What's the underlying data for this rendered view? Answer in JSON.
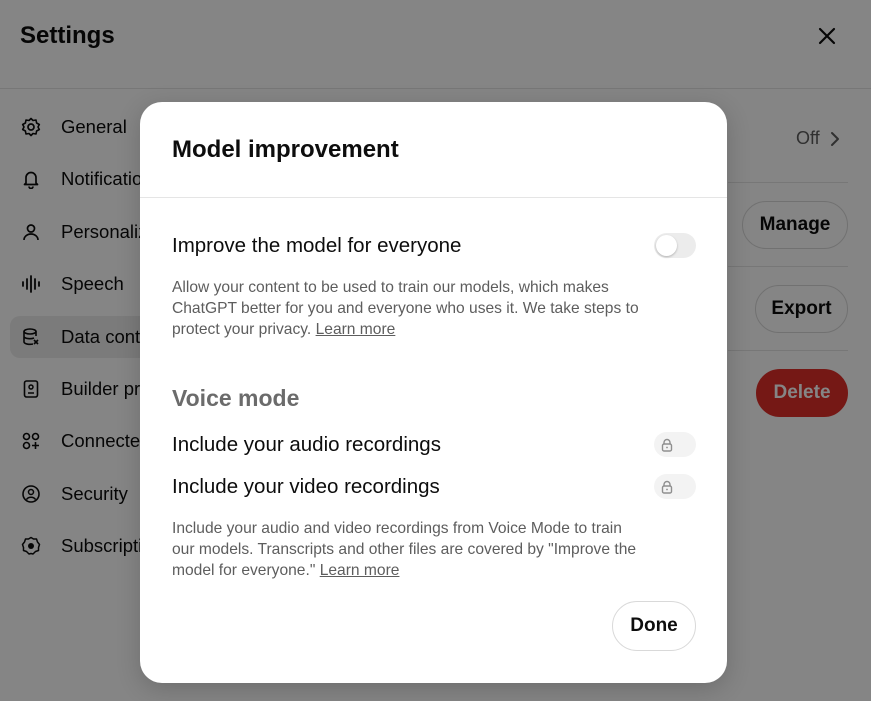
{
  "settings": {
    "title": "Settings",
    "sidebar": [
      {
        "label": "General",
        "icon": "gear-icon"
      },
      {
        "label": "Notifications",
        "icon": "bell-icon"
      },
      {
        "label": "Personalization",
        "icon": "person-icon"
      },
      {
        "label": "Speech",
        "icon": "waveform-icon"
      },
      {
        "label": "Data controls",
        "icon": "database-icon",
        "active": true
      },
      {
        "label": "Builder profile",
        "icon": "id-card-icon"
      },
      {
        "label": "Connected apps",
        "icon": "apps-icon"
      },
      {
        "label": "Security",
        "icon": "shield-icon"
      },
      {
        "label": "Subscription",
        "icon": "subscription-icon"
      }
    ],
    "content": {
      "improve_value": "Off",
      "manage_label": "Manage",
      "export_label": "Export",
      "delete_label": "Delete"
    }
  },
  "modal": {
    "title": "Model improvement",
    "improve": {
      "label": "Improve the model for everyone",
      "enabled": false,
      "description": "Allow your content to be used to train our models, which makes ChatGPT better for you and everyone who uses it. We take steps to protect your privacy.",
      "link": "Learn more"
    },
    "voice": {
      "section_title": "Voice mode",
      "audio_label": "Include your audio recordings",
      "video_label": "Include your video recordings",
      "audio_locked": true,
      "video_locked": true,
      "description": "Include your audio and video recordings from Voice Mode to train our models. Transcripts and other files are covered by \"Improve the model for everyone.\"",
      "link": "Learn more"
    },
    "done_label": "Done"
  },
  "colors": {
    "delete": "#e02e2a",
    "overlay": "rgba(0,0,0,0.48)",
    "toggle_off": "#ececec"
  }
}
